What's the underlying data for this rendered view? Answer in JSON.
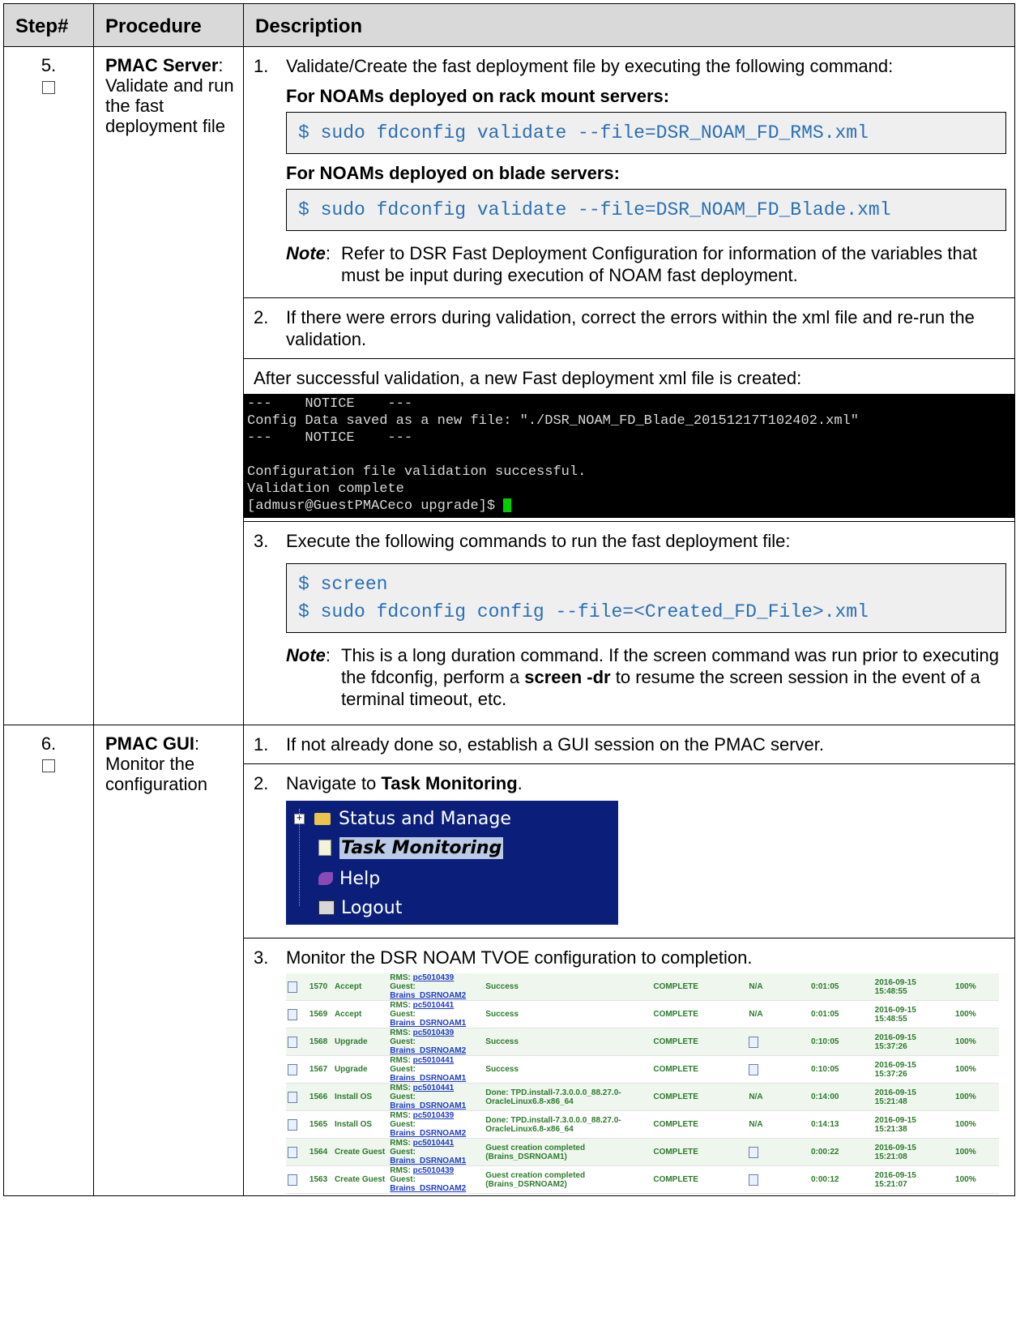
{
  "header": {
    "step": "Step#",
    "procedure": "Procedure",
    "description": "Description"
  },
  "step5": {
    "number": "5.",
    "proc_bold": "PMAC Server",
    "proc_rest": ": Validate and run the fast deployment file",
    "item1_num": "1.",
    "item1_text": "Validate/Create the fast deployment file by executing the following command:",
    "rms_head": "For NOAMs deployed on rack mount servers:",
    "rms_cmd": "$ sudo fdconfig validate --file=DSR_NOAM_FD_RMS.xml",
    "blade_head": "For NOAMs deployed on blade servers:",
    "blade_cmd": "$ sudo fdconfig validate --file=DSR_NOAM_FD_Blade.xml",
    "note_label": "Note",
    "note1_text": "Refer to DSR Fast Deployment Configuration for information of the variables that must be input during execution of NOAM fast deployment.",
    "item2_num": "2.",
    "item2_text": "If there were errors during validation, correct the errors within the xml file and re-run the validation.",
    "after_text": "After successful validation, a new Fast deployment xml file is created:",
    "terminal_lines": [
      "---    NOTICE    ---",
      "Config Data saved as a new file: \"./DSR_NOAM_FD_Blade_20151217T102402.xml\"",
      "---    NOTICE    ---",
      "",
      "Configuration file validation successful.",
      "Validation complete"
    ],
    "terminal_prompt": "[admusr@GuestPMACeco upgrade]$ ",
    "item3_num": "3.",
    "item3_text": "Execute the following commands to run the fast deployment file:",
    "run_cmd1": "$ screen",
    "run_cmd2": "$ sudo fdconfig config --file=<Created_FD_File>.xml",
    "note2_a": "This is a long duration command.  If the screen command was run prior to executing the fdconfig, perform a ",
    "note2_bold": "screen -dr",
    "note2_b": " to resume the screen session in the event of a terminal timeout, etc."
  },
  "step6": {
    "number": "6.",
    "proc_bold": "PMAC GUI",
    "proc_rest": ": Monitor the configuration",
    "item1_num": "1.",
    "item1_text": "If not already done so, establish a GUI session on the PMAC server.",
    "item2_num": "2.",
    "item2_pre": "Navigate to ",
    "item2_bold": "Task Monitoring",
    "item2_post": ".",
    "menu": {
      "status": "Status and Manage",
      "task": "Task Monitoring",
      "help": "Help",
      "logout": "Logout"
    },
    "item3_num": "3.",
    "item3_text": "Monitor the DSR NOAM TVOE configuration to completion.",
    "tasks": [
      {
        "id": "1570",
        "name": "Accept",
        "rms": "pc5010439",
        "guest": "Brains_DSRNOAM2",
        "status": "Success",
        "state": "COMPLETE",
        "result": "N/A",
        "running": "0:01:05",
        "date": "2016-09-15",
        "time": "15:48:55",
        "progress": "100%"
      },
      {
        "id": "1569",
        "name": "Accept",
        "rms": "pc5010441",
        "guest": "Brains_DSRNOAM1",
        "status": "Success",
        "state": "COMPLETE",
        "result": "N/A",
        "running": "0:01:05",
        "date": "2016-09-15",
        "time": "15:48:55",
        "progress": "100%"
      },
      {
        "id": "1568",
        "name": "Upgrade",
        "rms": "pc5010439",
        "guest": "Brains_DSRNOAM2",
        "status": "Success",
        "state": "COMPLETE",
        "result": "",
        "running": "0:10:05",
        "date": "2016-09-15",
        "time": "15:37:26",
        "progress": "100%"
      },
      {
        "id": "1567",
        "name": "Upgrade",
        "rms": "pc5010441",
        "guest": "Brains_DSRNOAM1",
        "status": "Success",
        "state": "COMPLETE",
        "result": "",
        "running": "0:10:05",
        "date": "2016-09-15",
        "time": "15:37:26",
        "progress": "100%"
      },
      {
        "id": "1566",
        "name": "Install OS",
        "rms": "pc5010441",
        "guest": "Brains_DSRNOAM1",
        "status": "Done: TPD.install-7.3.0.0.0_88.27.0-OracleLinux6.8-x86_64",
        "state": "COMPLETE",
        "result": "N/A",
        "running": "0:14:00",
        "date": "2016-09-15",
        "time": "15:21:48",
        "progress": "100%"
      },
      {
        "id": "1565",
        "name": "Install OS",
        "rms": "pc5010439",
        "guest": "Brains_DSRNOAM2",
        "status": "Done: TPD.install-7.3.0.0.0_88.27.0-OracleLinux6.8-x86_64",
        "state": "COMPLETE",
        "result": "N/A",
        "running": "0:14:13",
        "date": "2016-09-15",
        "time": "15:21:38",
        "progress": "100%"
      },
      {
        "id": "1564",
        "name": "Create Guest",
        "rms": "pc5010441",
        "guest": "Brains_DSRNOAM1",
        "status": "Guest creation completed (Brains_DSRNOAM1)",
        "state": "COMPLETE",
        "result": "",
        "running": "0:00:22",
        "date": "2016-09-15",
        "time": "15:21:08",
        "progress": "100%"
      },
      {
        "id": "1563",
        "name": "Create Guest",
        "rms": "pc5010439",
        "guest": "Brains_DSRNOAM2",
        "status": "Guest creation completed (Brains_DSRNOAM2)",
        "state": "COMPLETE",
        "result": "",
        "running": "0:00:12",
        "date": "2016-09-15",
        "time": "15:21:07",
        "progress": "100%"
      }
    ],
    "labels": {
      "rms": "RMS: ",
      "guest": "Guest: "
    }
  }
}
